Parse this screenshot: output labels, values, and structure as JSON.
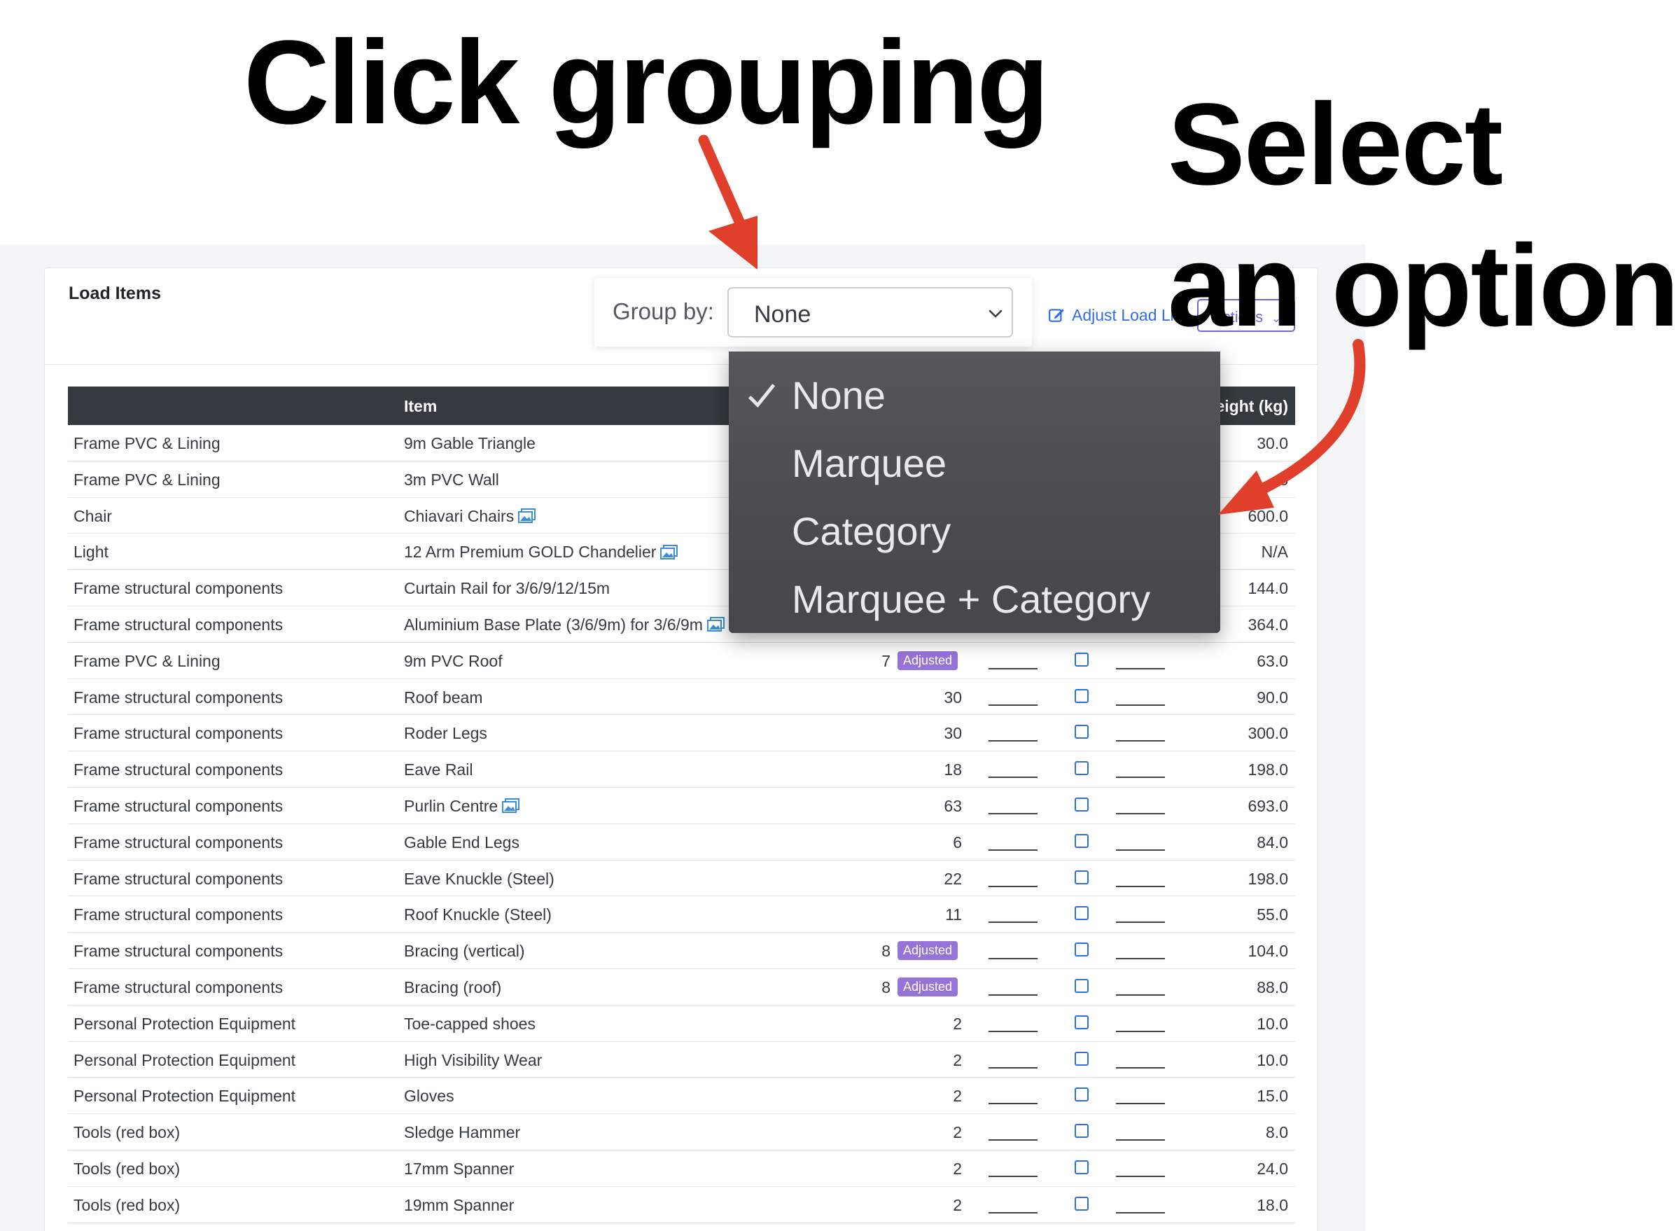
{
  "annotations": {
    "line1": "Click grouping",
    "line2": "Select",
    "line3": "an option"
  },
  "card": {
    "title": "Load Items"
  },
  "group_by": {
    "label": "Group by:",
    "value": "None",
    "options": [
      "None",
      "Marquee",
      "Category",
      "Marquee + Category"
    ]
  },
  "toolbar": {
    "adjust_label": "Adjust Load List",
    "actions_label": "Actions"
  },
  "table": {
    "headers": {
      "item": "Item",
      "weight": "eight (kg)"
    },
    "badge_label": "Adjusted",
    "rows": [
      {
        "category": "Frame PVC & Lining",
        "item": "9m Gable Triangle",
        "qty": "",
        "adjusted": false,
        "weight": "30.0",
        "image": false
      },
      {
        "category": "Frame PVC & Lining",
        "item": "3m PVC Wall",
        "qty": "",
        "adjusted": false,
        "weight": "8",
        "image": false
      },
      {
        "category": "Chair",
        "item": "Chiavari Chairs",
        "qty": "",
        "adjusted": false,
        "weight": "600.0",
        "image": true
      },
      {
        "category": "Light",
        "item": "12 Arm Premium GOLD Chandelier",
        "qty": "",
        "adjusted": false,
        "weight": "N/A",
        "image": true
      },
      {
        "category": "Frame structural components",
        "item": "Curtain Rail for 3/6/9/12/15m",
        "qty": "",
        "adjusted": false,
        "weight": "144.0",
        "image": false
      },
      {
        "category": "Frame structural components",
        "item": "Aluminium Base Plate (3/6/9m) for 3/6/9m",
        "qty": "",
        "adjusted": false,
        "weight": "364.0",
        "image": true
      },
      {
        "category": "Frame PVC & Lining",
        "item": "9m PVC Roof",
        "qty": "7",
        "adjusted": true,
        "weight": "63.0",
        "image": false
      },
      {
        "category": "Frame structural components",
        "item": "Roof beam",
        "qty": "30",
        "adjusted": false,
        "weight": "90.0",
        "image": false
      },
      {
        "category": "Frame structural components",
        "item": "Roder Legs",
        "qty": "30",
        "adjusted": false,
        "weight": "300.0",
        "image": false
      },
      {
        "category": "Frame structural components",
        "item": "Eave Rail",
        "qty": "18",
        "adjusted": false,
        "weight": "198.0",
        "image": false
      },
      {
        "category": "Frame structural components",
        "item": "Purlin Centre",
        "qty": "63",
        "adjusted": false,
        "weight": "693.0",
        "image": true
      },
      {
        "category": "Frame structural components",
        "item": "Gable End Legs",
        "qty": "6",
        "adjusted": false,
        "weight": "84.0",
        "image": false
      },
      {
        "category": "Frame structural components",
        "item": "Eave Knuckle (Steel)",
        "qty": "22",
        "adjusted": false,
        "weight": "198.0",
        "image": false
      },
      {
        "category": "Frame structural components",
        "item": "Roof Knuckle (Steel)",
        "qty": "11",
        "adjusted": false,
        "weight": "55.0",
        "image": false
      },
      {
        "category": "Frame structural components",
        "item": "Bracing (vertical)",
        "qty": "8",
        "adjusted": true,
        "weight": "104.0",
        "image": false
      },
      {
        "category": "Frame structural components",
        "item": "Bracing (roof)",
        "qty": "8",
        "adjusted": true,
        "weight": "88.0",
        "image": false
      },
      {
        "category": "Personal Protection Equipment",
        "item": "Toe-capped shoes",
        "qty": "2",
        "adjusted": false,
        "weight": "10.0",
        "image": false
      },
      {
        "category": "Personal Protection Equipment",
        "item": "High Visibility Wear",
        "qty": "2",
        "adjusted": false,
        "weight": "10.0",
        "image": false
      },
      {
        "category": "Personal Protection Equipment",
        "item": "Gloves",
        "qty": "2",
        "adjusted": false,
        "weight": "15.0",
        "image": false
      },
      {
        "category": "Tools (red box)",
        "item": "Sledge Hammer",
        "qty": "2",
        "adjusted": false,
        "weight": "8.0",
        "image": false
      },
      {
        "category": "Tools (red box)",
        "item": "17mm Spanner",
        "qty": "2",
        "adjusted": false,
        "weight": "24.0",
        "image": false
      },
      {
        "category": "Tools (red box)",
        "item": "19mm Spanner",
        "qty": "2",
        "adjusted": false,
        "weight": "18.0",
        "image": false
      }
    ]
  },
  "colors": {
    "accent_blue": "#2f6ee6",
    "badge_purple": "#9673d8",
    "header_dark": "#343a40",
    "arrow_red": "#e0402b"
  }
}
